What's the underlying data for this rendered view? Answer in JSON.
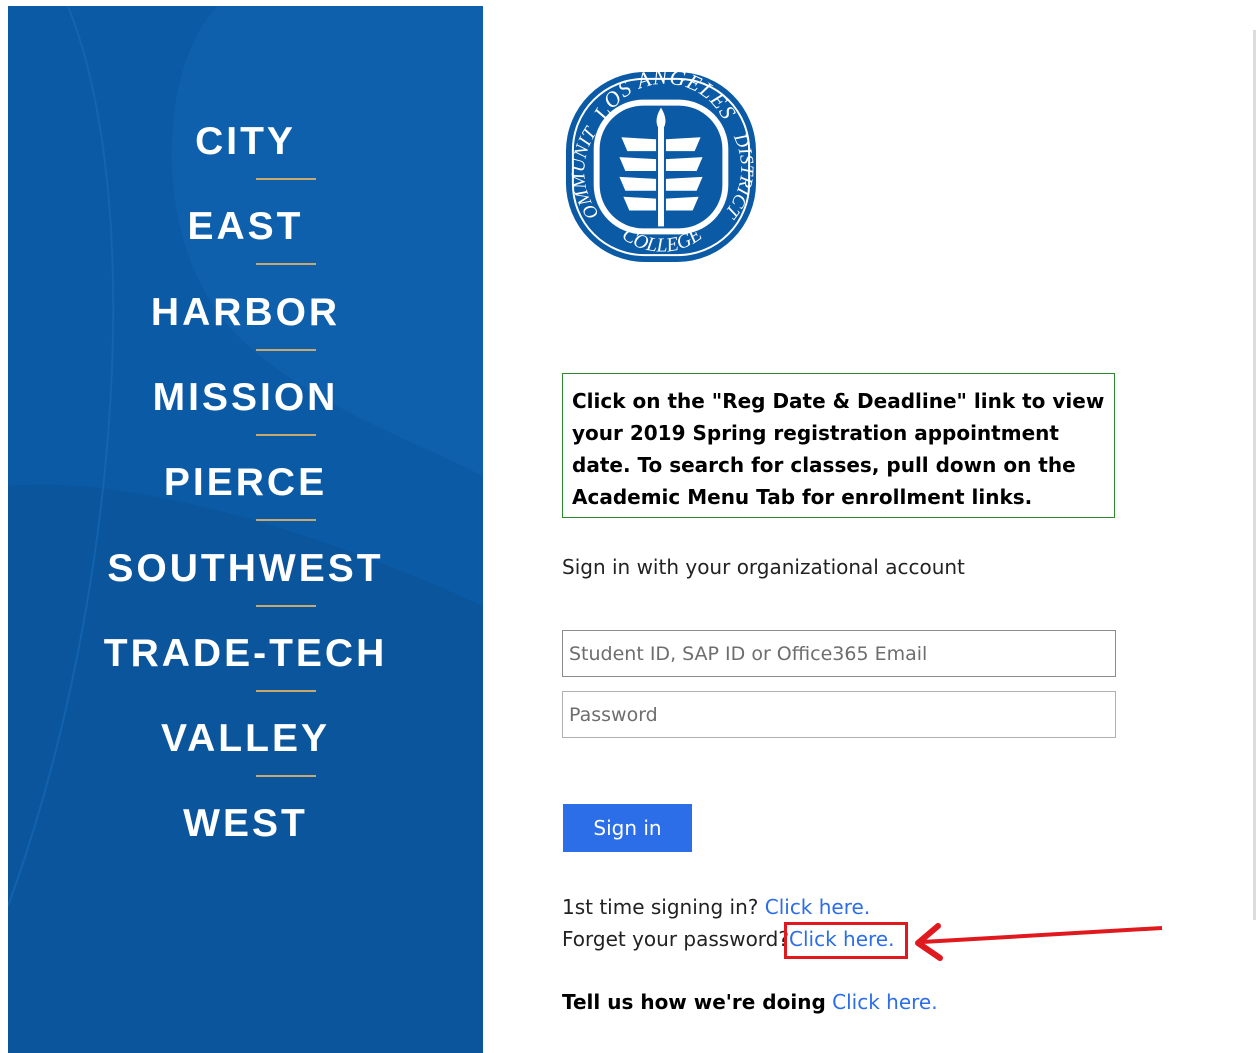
{
  "colleges": [
    "CITY",
    "EAST",
    "HARBOR",
    "MISSION",
    "PIERCE",
    "SOUTHWEST",
    "TRADE-TECH",
    "VALLEY",
    "WEST"
  ],
  "logo": {
    "top_text": "LOS ANGELES",
    "left_text": "COMMUNITY",
    "bottom_text": "COLLEGE",
    "right_text": "DISTRICT"
  },
  "notice": {
    "text": "Click on the \"Reg Date & Deadline\" link to view your 2019 Spring registration appointment date. To search for classes, pull down on the Academic Menu Tab for enrollment links."
  },
  "signin": {
    "heading": "Sign in with your organizational account",
    "username_placeholder": "Student ID, SAP ID or Office365 Email",
    "password_placeholder": "Password",
    "button_label": "Sign in"
  },
  "links": {
    "first_time_text": "1st time signing in?",
    "first_time_link": "Click here.",
    "forgot_text": "Forget your password?",
    "forgot_link": "Click here.",
    "feedback_text": "Tell us how we're doing",
    "feedback_link": "Click here."
  },
  "colors": {
    "panel_blue": "#0b5aa5",
    "divider_gold": "#c7a86d",
    "accent_blue": "#2b6ee8",
    "notice_border": "#2b8a2b",
    "annotation_red": "#e0191f"
  }
}
